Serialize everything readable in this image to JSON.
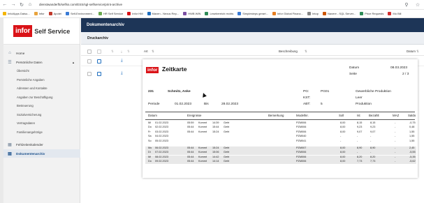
{
  "browser": {
    "url": "dienstwanderf5/selfss.com/ESS/sgl-selfservice/print-archive",
    "bookmarks": [
      "Info/Apps Daiso...",
      "Infor",
      "Apotei",
      "Self-Environment...",
      "HR Self Service",
      "Infor HM",
      "Maven - Nexus Rep...",
      "HWB WIN",
      "Lesebereich rechts",
      "Simplesteps gerart...",
      "Infor Global Financ...",
      "Intop",
      "Navere - SQL Server...",
      "Price Requests",
      "Mo Bill"
    ]
  },
  "app": {
    "brand_text": "Self Service",
    "header_title": "Dokumentenarchiv",
    "subheader": "Druckarchiv"
  },
  "sidebar": {
    "home": "Home",
    "personal": "Persönliche Daten",
    "sub_items": [
      "Übersicht",
      "Persönliche Angaben",
      "Adressen und Kontakte",
      "Angaben zur Beschäftigung",
      "Besteuerung",
      "Sozialversicherung",
      "Vertragsdaten",
      "Familienangehörige"
    ],
    "calendar": "Fehlzeitenkalender",
    "archive": "Dokumentenarchiv"
  },
  "table": {
    "col_art": "Art",
    "col_desc": "Beschreibung",
    "col_date": "Datum",
    "rows": [
      {
        "art": "Zeiterfassungsbeleg",
        "desc": "ZEB_202303.pdf",
        "date": "21.03.2023"
      }
    ]
  },
  "document": {
    "logo": "infor",
    "title": "Zeitkarte",
    "datum_label": "Datum",
    "datum_value": "08.03.2023",
    "seite_label": "Seite",
    "seite_value": "2 / 3",
    "emp_no": "231",
    "emp_name": "Schmitz, Anke",
    "pg_label": "PG:",
    "pg_value": "PG01",
    "pg_desc": "Gewerbliche Produktion",
    "kst_label": "KST:",
    "kst_desc": "Leer",
    "abt_label": "ABT:",
    "abt_value": "5",
    "abt_desc": "Produktion",
    "periode_label": "Periode",
    "periode_from": "01.02.2023",
    "bis_label": "Bis",
    "periode_to": "28.02.2023",
    "headers": [
      "Datum",
      "Ereignisse",
      "Bemerkung",
      "Modellnr.",
      "Soll",
      "Ist",
      "Bezahlt",
      "MAZ",
      "Saldo"
    ],
    "rows": [
      {
        "day": "Mi",
        "date": "01.02.2023",
        "t1": "05:59",
        "e1": "Kommt",
        "t2": "14:39",
        "e2": "Geht",
        "model": "PZM006",
        "soll": "8,00",
        "ist": "8,15",
        "bez": "8,15",
        "maz": "-",
        "saldo": "-0,75"
      },
      {
        "day": "Do",
        "date": "02.02.2023",
        "t1": "05:44",
        "e1": "Kommt",
        "t2": "15:44",
        "e2": "Geht",
        "model": "PZM006",
        "soll": "8,00",
        "ist": "9,23",
        "bez": "9,23",
        "maz": "-",
        "saldo": "0,48"
      },
      {
        "day": "Fr",
        "date": "03.02.2023",
        "t1": "05:44",
        "e1": "Kommt",
        "t2": "15:24",
        "e2": "Geht",
        "model": "PZM006",
        "soll": "8,00",
        "ist": "9,07",
        "bez": "9,07",
        "maz": "-",
        "saldo": "1,55"
      },
      {
        "day": "Sa",
        "date": "04.02.2023",
        "t1": "",
        "e1": "",
        "t2": "",
        "e2": "",
        "model": "PZM040",
        "soll": "-",
        "ist": "-",
        "bez": "-",
        "maz": "-",
        "saldo": "1,55"
      },
      {
        "day": "So",
        "date": "05.02.2023",
        "t1": "",
        "e1": "",
        "t2": "",
        "e2": "",
        "model": "PZM041",
        "soll": "-",
        "ist": "-",
        "bez": "-",
        "maz": "-",
        "saldo": "1,55"
      },
      {
        "day": "Mo",
        "date": "06.02.2023",
        "t1": "05:44",
        "e1": "Kommt",
        "t2": "15:24",
        "e2": "Geht",
        "model": "PZM007",
        "soll": "8,00",
        "ist": "8,90",
        "bez": "8,90",
        "maz": "-",
        "saldo": "2,45"
      },
      {
        "day": "Di",
        "date": "07.02.2023",
        "t1": "05:44",
        "e1": "Kommt",
        "t2": "15:06",
        "e2": "Geht",
        "model": "PZM006",
        "soll": "8,00",
        "ist": "-",
        "bez": "-",
        "maz": "-",
        "saldo": "-5,55"
      },
      {
        "day": "Mi",
        "date": "08.02.2023",
        "t1": "05:44",
        "e1": "Kommt",
        "t2": "14:42",
        "e2": "Geht",
        "model": "PZM006",
        "soll": "8,00",
        "ist": "8,20",
        "bez": "8,20",
        "maz": "-",
        "saldo": "-5,35"
      },
      {
        "day": "Do",
        "date": "09.02.2023",
        "t1": "05:44",
        "e1": "Kommt",
        "t2": "14:14",
        "e2": "Geht",
        "model": "PZM006",
        "soll": "8,00",
        "ist": "7,73",
        "bez": "7,73",
        "maz": "-",
        "saldo": "-5,62"
      }
    ]
  }
}
